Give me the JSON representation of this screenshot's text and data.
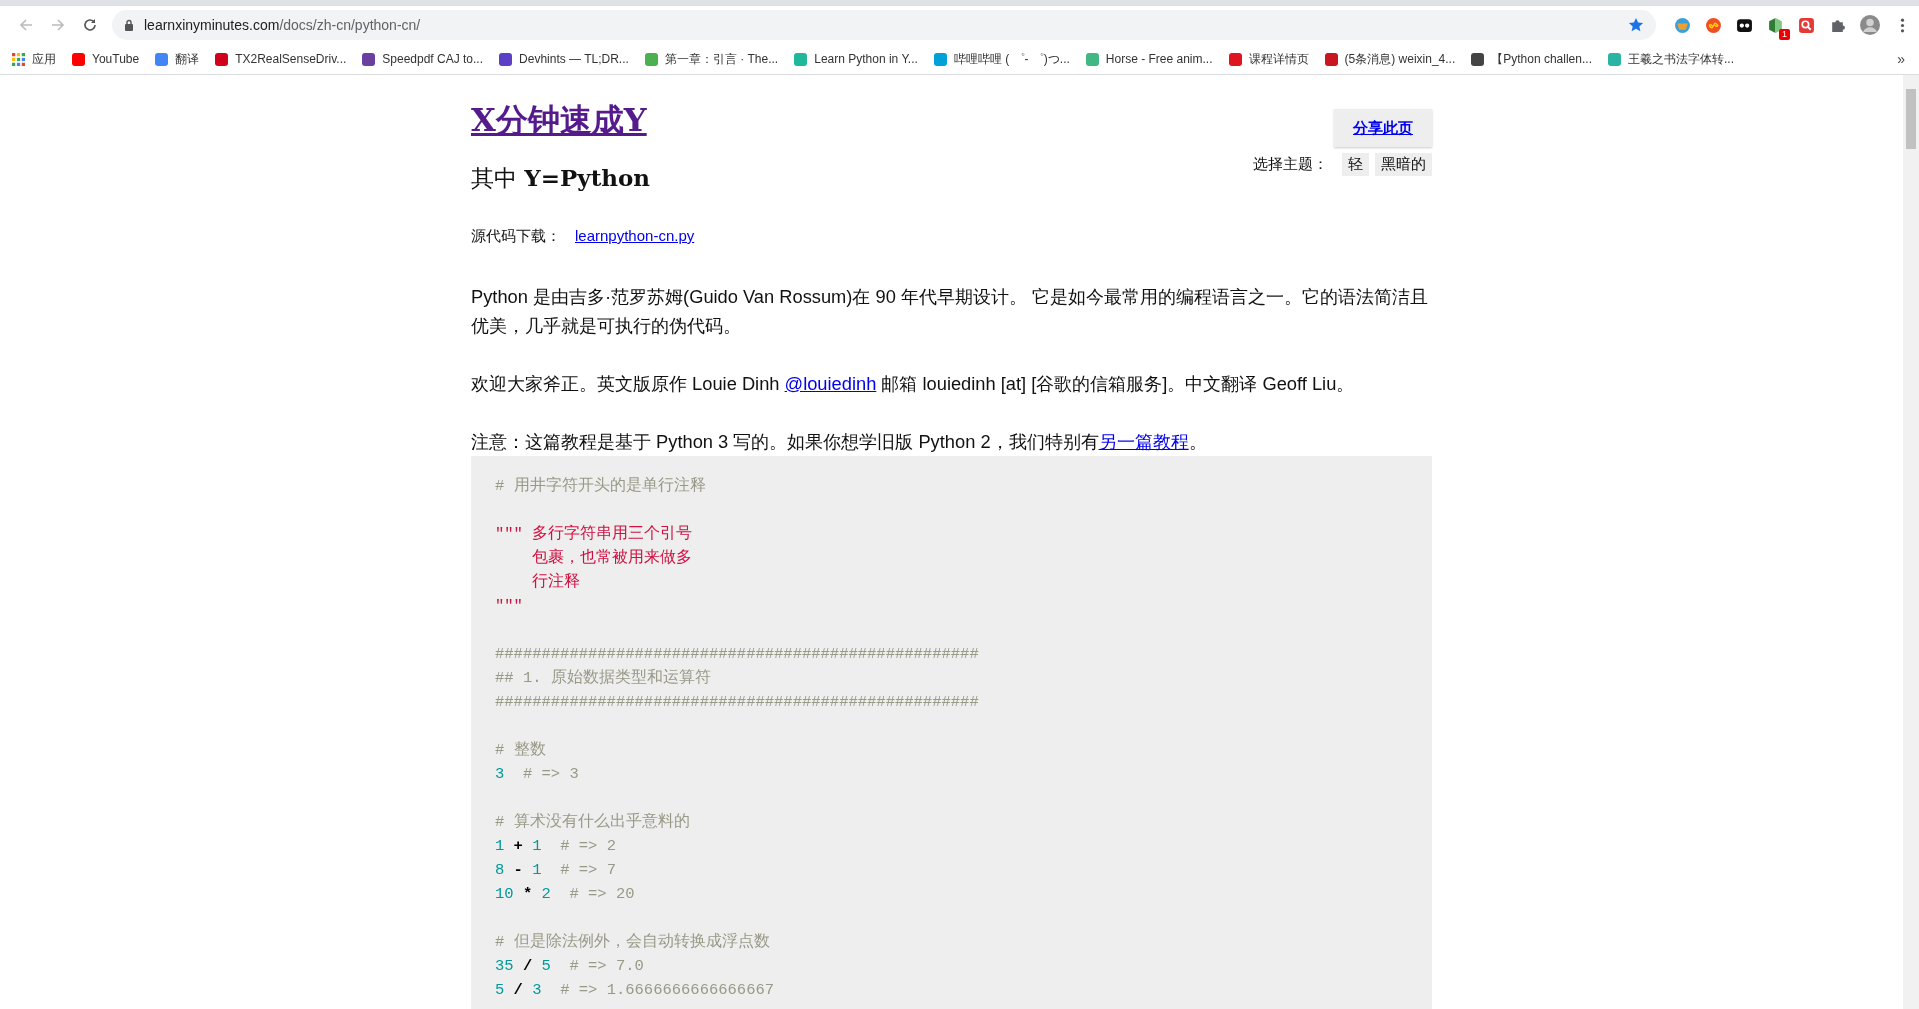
{
  "browser": {
    "url": "learnxinyminutes.com/docs/zh-cn/python-cn/",
    "extension_badge": "1",
    "bookmarks": [
      {
        "kind": "apps",
        "label": "应用"
      },
      {
        "kind": "site",
        "label": "YouTube",
        "color": "#ff0000"
      },
      {
        "kind": "site",
        "label": "翻译",
        "color": "#4285f4"
      },
      {
        "kind": "site",
        "label": "TX2RealSenseDriv...",
        "color": "#d0021b"
      },
      {
        "kind": "site",
        "label": "Speedpdf CAJ to...",
        "color": "#6b3fa0"
      },
      {
        "kind": "site",
        "label": "Devhints — TL;DR...",
        "color": "#5b3fc4"
      },
      {
        "kind": "site",
        "label": "第一章：引言 · The...",
        "color": "#4caf50"
      },
      {
        "kind": "site",
        "label": "Learn Python in Y...",
        "color": "#1fb89a"
      },
      {
        "kind": "site",
        "label": "哔哩哔哩 ( ゜- ゜)つ...",
        "color": "#00a1d6"
      },
      {
        "kind": "site",
        "label": "Horse - Free anim...",
        "color": "#41b883"
      },
      {
        "kind": "site",
        "label": "课程详情页",
        "color": "#e0141e"
      },
      {
        "kind": "site",
        "label": "(5条消息) weixin_4...",
        "color": "#c81623"
      },
      {
        "kind": "site",
        "label": "【Python challen...",
        "color": "#444444"
      },
      {
        "kind": "site",
        "label": "王羲之书法字体转...",
        "color": "#2bb3a3"
      }
    ],
    "more_bookmarks": "»"
  },
  "page": {
    "title": "X分钟速成Y",
    "subtitle": "其中 **Y=Python**",
    "share_button": "分享此页",
    "theme_label": "选择主题：",
    "themes": [
      "轻",
      "黑暗的"
    ],
    "source_label": "源代码下载：",
    "source_link": "learnpython-cn.py",
    "paragraphs": [
      [
        {
          "kind": "text",
          "text": "Python 是由吉多·范罗苏姆(Guido Van Rossum)在 90 年代早期设计。 它是如今最常用的编程语言之一。它的语法简洁且优美，几乎就是可执行的伪代码。"
        }
      ],
      [
        {
          "kind": "text",
          "text": "欢迎大家斧正。英文版原作 Louie Dinh "
        },
        {
          "kind": "link",
          "text": "@louiedinh"
        },
        {
          "kind": "text",
          "text": " 邮箱 louiedinh [at] [谷歌的信箱服务]。中文翻译 Geoff Liu。"
        }
      ],
      [
        {
          "kind": "text",
          "text": "注意：这篇教程是基于 Python 3 写的。如果你想学旧版 Python 2，我们特别有"
        },
        {
          "kind": "link",
          "text": "另一篇教程"
        },
        {
          "kind": "text",
          "text": "。"
        }
      ]
    ],
    "code_blocks": [
      [
        [
          {
            "kind": "comment",
            "text": "# 用井字符开头的是单行注释"
          }
        ]
      ],
      [
        [
          {
            "kind": "string",
            "text": "\"\"\" 多行字符串用三个引号"
          }
        ],
        [
          {
            "kind": "string",
            "text": "    包裹，也常被用来做多"
          }
        ],
        [
          {
            "kind": "string",
            "text": "    行注释"
          }
        ],
        [
          {
            "kind": "string",
            "text": "\"\"\""
          }
        ]
      ],
      [
        [
          {
            "kind": "comment",
            "text": "####################################################"
          }
        ],
        [
          {
            "kind": "comment",
            "text": "## 1. 原始数据类型和运算符"
          }
        ],
        [
          {
            "kind": "comment",
            "text": "####################################################"
          }
        ]
      ],
      [
        [
          {
            "kind": "comment",
            "text": "# 整数"
          }
        ],
        [
          {
            "kind": "number",
            "text": "3"
          },
          {
            "kind": "comment",
            "text": "  # => 3"
          }
        ]
      ],
      [
        [
          {
            "kind": "comment",
            "text": "# 算术没有什么出乎意料的"
          }
        ],
        [
          {
            "kind": "number",
            "text": "1"
          },
          {
            "kind": "operator",
            "text": " + "
          },
          {
            "kind": "number",
            "text": "1"
          },
          {
            "kind": "comment",
            "text": "  # => 2"
          }
        ],
        [
          {
            "kind": "number",
            "text": "8"
          },
          {
            "kind": "operator",
            "text": " - "
          },
          {
            "kind": "number",
            "text": "1"
          },
          {
            "kind": "comment",
            "text": "  # => 7"
          }
        ],
        [
          {
            "kind": "number",
            "text": "10"
          },
          {
            "kind": "operator",
            "text": " * "
          },
          {
            "kind": "number",
            "text": "2"
          },
          {
            "kind": "comment",
            "text": "  # => 20"
          }
        ]
      ],
      [
        [
          {
            "kind": "comment",
            "text": "# 但是除法例外，会自动转换成浮点数"
          }
        ],
        [
          {
            "kind": "number",
            "text": "35"
          },
          {
            "kind": "operator",
            "text": " / "
          },
          {
            "kind": "number",
            "text": "5"
          },
          {
            "kind": "comment",
            "text": "  # => 7.0"
          }
        ],
        [
          {
            "kind": "number",
            "text": "5"
          },
          {
            "kind": "operator",
            "text": " / "
          },
          {
            "kind": "number",
            "text": "3"
          },
          {
            "kind": "comment",
            "text": "  # => 1.6666666666666667"
          }
        ]
      ]
    ]
  }
}
